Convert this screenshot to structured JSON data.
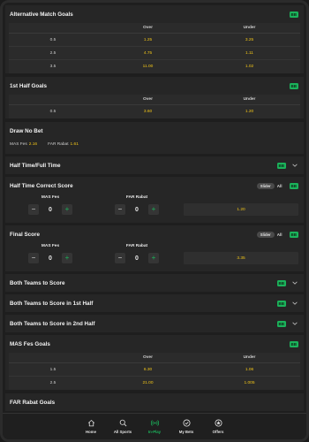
{
  "badge": "BB",
  "alt_goals": {
    "title": "Alternative Match Goals",
    "headers": [
      "Over",
      "Under"
    ],
    "rows": [
      {
        "line": "0.5",
        "over": "1.25",
        "under": "3.25"
      },
      {
        "line": "2.5",
        "over": "4.75",
        "under": "1.11"
      },
      {
        "line": "3.5",
        "over": "11.00",
        "under": "1.02"
      }
    ]
  },
  "first_half_goals": {
    "title": "1st Half Goals",
    "headers": [
      "Over",
      "Under"
    ],
    "rows": [
      {
        "line": "0.5",
        "over": "3.60",
        "under": "1.20"
      }
    ]
  },
  "draw_no_bet": {
    "title": "Draw No Bet",
    "home_label": "MAS Fes",
    "home_odd": "2.16",
    "away_label": "FAR Rabat",
    "away_odd": "1.61"
  },
  "ht_ft": {
    "title": "Half Time/Full Time"
  },
  "ht_correct_score": {
    "title": "Half Time Correct Score",
    "slider": "Slider",
    "all": "All",
    "home": "MAS Fes",
    "away": "FAR Rabat",
    "home_score": "0",
    "away_score": "0",
    "odd": "1.20"
  },
  "final_score": {
    "title": "Final Score",
    "slider": "Slider",
    "all": "All",
    "home": "MAS Fes",
    "away": "FAR Rabat",
    "home_score": "0",
    "away_score": "0",
    "odd": "3.35"
  },
  "btts": {
    "title": "Both Teams to Score"
  },
  "btts_1h": {
    "title": "Both Teams to Score in 1st Half"
  },
  "btts_2h": {
    "title": "Both Teams to Score in 2nd Half"
  },
  "mas_goals": {
    "title": "MAS Fes Goals",
    "headers": [
      "Over",
      "Under"
    ],
    "rows": [
      {
        "line": "1.5",
        "over": "6.30",
        "under": "1.06"
      },
      {
        "line": "2.5",
        "over": "21.00",
        "under": "1.005"
      }
    ]
  },
  "far_goals": {
    "title": "FAR Rabat Goals"
  },
  "nav": [
    {
      "label": "Home",
      "icon": "home-icon"
    },
    {
      "label": "All Sports",
      "icon": "search-icon"
    },
    {
      "label": "In-Play",
      "icon": "live-icon"
    },
    {
      "label": "My Bets",
      "icon": "check-circle-icon"
    },
    {
      "label": "Offers",
      "icon": "offers-icon"
    }
  ],
  "colors": {
    "accent": "#1bb35b",
    "odds": "#f0c419",
    "background": "#1e1e1e",
    "panel": "#262626"
  }
}
